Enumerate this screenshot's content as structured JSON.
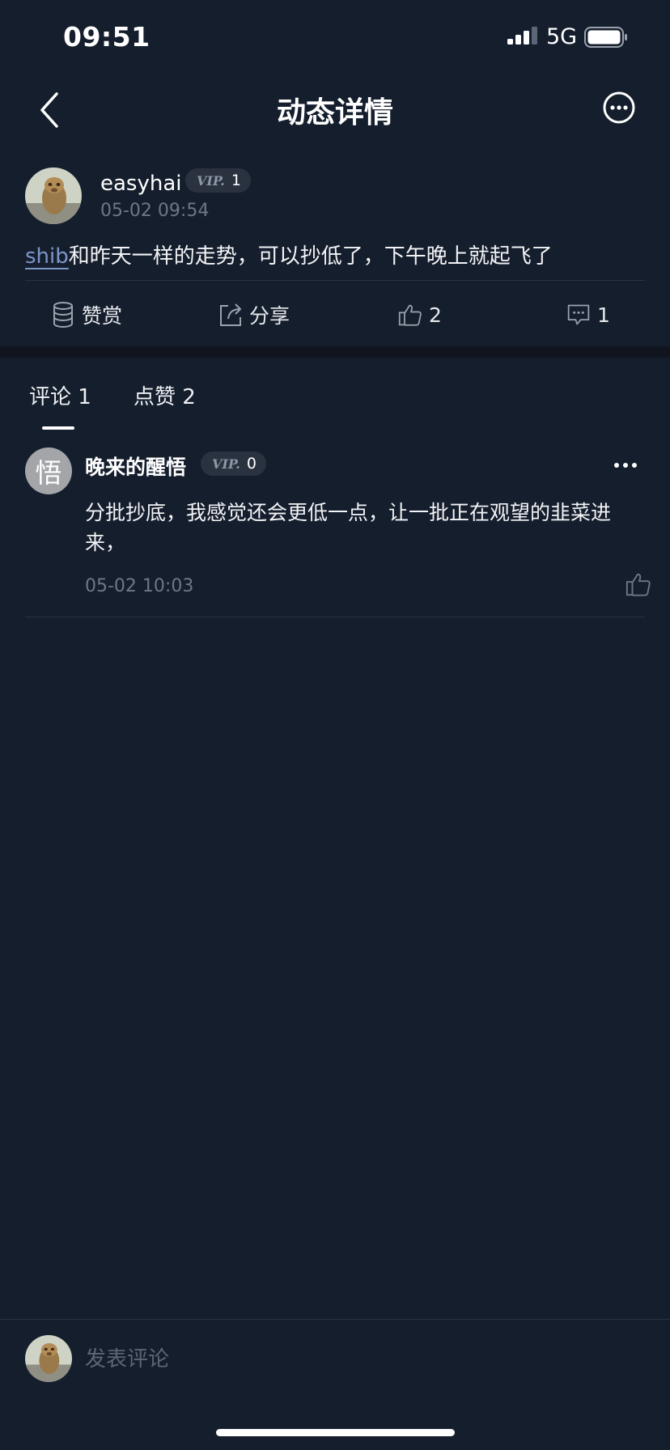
{
  "status_bar": {
    "time": "09:51",
    "network": "5G"
  },
  "nav": {
    "title": "动态详情"
  },
  "post": {
    "username": "easyhai",
    "vip_level": "1",
    "timestamp": "05-02 09:54",
    "tag": "shib",
    "content": "和昨天一样的走势，可以抄低了，下午晚上就起飞了"
  },
  "actions": {
    "reward_label": "赞赏",
    "share_label": "分享",
    "like_count": "2",
    "comment_count": "1"
  },
  "tabs": [
    {
      "label": "评论 1",
      "active": true
    },
    {
      "label": "点赞 2",
      "active": false
    }
  ],
  "comments": [
    {
      "avatar_char": "悟",
      "username": "晚来的醒悟",
      "vip_level": "0",
      "text": "分批抄底，我感觉还会更低一点，让一批正在观望的韭菜进来，",
      "timestamp": "05-02 10:03"
    }
  ],
  "vip_label": "VIP.",
  "composer": {
    "placeholder": "发表评论"
  },
  "colors": {
    "background": "#151e2d",
    "accent_link": "#7d96c8",
    "muted_text": "#6e7787"
  }
}
